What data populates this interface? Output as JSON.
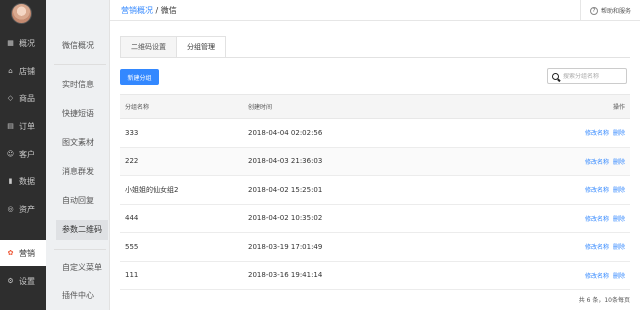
{
  "sidebar": {
    "items": [
      {
        "label": "概况",
        "icon": "dashboard-icon",
        "glyph": "▦"
      },
      {
        "label": "店铺",
        "icon": "store-icon",
        "glyph": "⌂"
      },
      {
        "label": "商品",
        "icon": "tag-icon",
        "glyph": "◇"
      },
      {
        "label": "订单",
        "icon": "order-icon",
        "glyph": "▤"
      },
      {
        "label": "客户",
        "icon": "user-icon",
        "glyph": "☺"
      },
      {
        "label": "数据",
        "icon": "chart-icon",
        "glyph": "▮"
      },
      {
        "label": "资产",
        "icon": "asset-icon",
        "glyph": "◎"
      },
      {
        "label": "营销",
        "icon": "marketing-icon",
        "glyph": "✿"
      },
      {
        "label": "设置",
        "icon": "settings-icon",
        "glyph": "⚙"
      }
    ]
  },
  "subnav": {
    "items": [
      "微信概况",
      "实时信息",
      "快捷短语",
      "图文素材",
      "消息群发",
      "自动回复",
      "参数二维码",
      "自定义菜单",
      "插件中心"
    ]
  },
  "header": {
    "crumb_link": "营销概况",
    "crumb_sep": "/",
    "crumb_current": "微信",
    "help_label": "帮助和服务",
    "help_glyph": "?"
  },
  "tabs": [
    "二维码设置",
    "分组管理"
  ],
  "toolbar": {
    "new_button": "新建分组",
    "search_placeholder": "搜索分组名称"
  },
  "table": {
    "headers": [
      "分组名称",
      "创建时间",
      "操作"
    ],
    "rows": [
      {
        "name": "333",
        "time": "2018-04-04 02:02:56"
      },
      {
        "name": "222",
        "time": "2018-04-03 21:36:03"
      },
      {
        "name": "小姐姐的仙女组2",
        "time": "2018-04-02 15:25:01"
      },
      {
        "name": "444",
        "time": "2018-04-02 10:35:02"
      },
      {
        "name": "555",
        "time": "2018-03-19 17:01:49"
      },
      {
        "name": "111",
        "time": "2018-03-16 19:41:14"
      }
    ],
    "actions": {
      "edit": "修改名称",
      "delete": "删除"
    }
  },
  "pager": {
    "text": "共 6 条，10条每页"
  },
  "colors": {
    "accent": "#3388ff",
    "sidebar_bg": "#2e2e2e",
    "marketing_icon": "#ee5533"
  }
}
